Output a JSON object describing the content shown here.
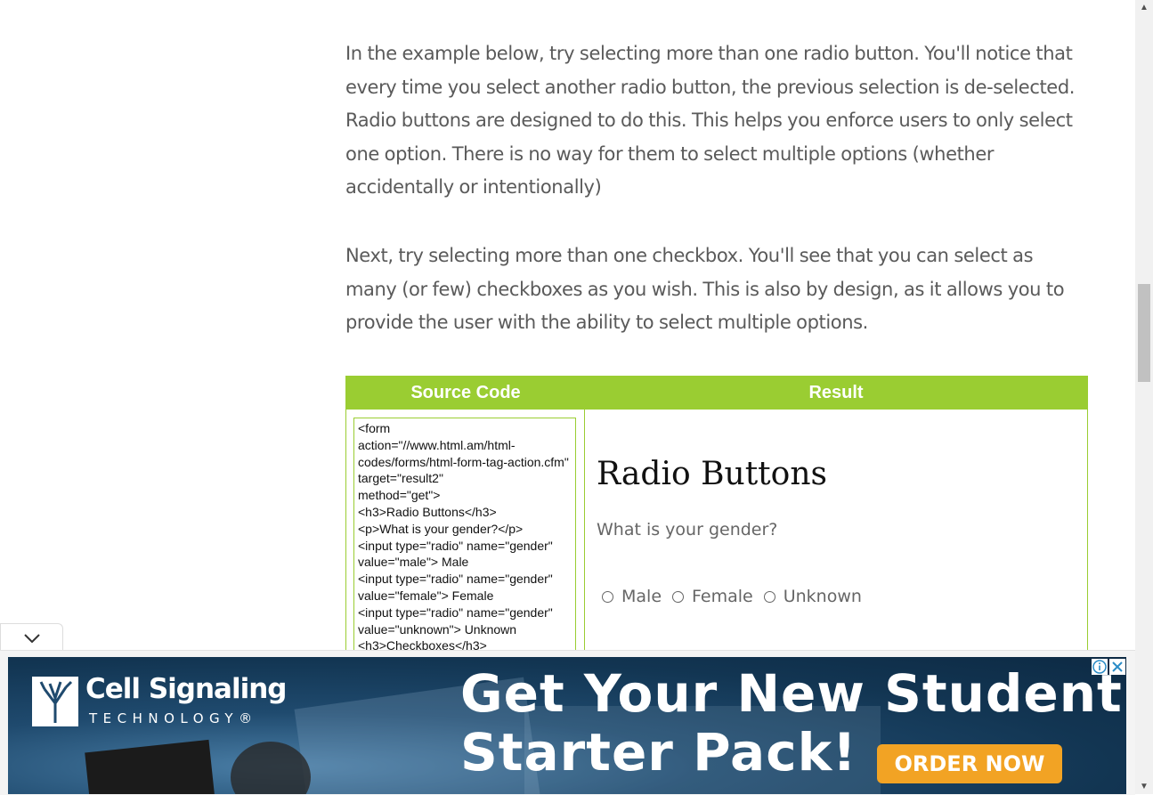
{
  "article": {
    "paragraph_1": "In the example below, try selecting more than one radio button. You'll notice that every time you select another radio button, the previous selection is de-selected. Radio buttons are designed to do this. This helps you enforce users to only select one option. There is no way for them to select multiple options (whether accidentally or intentionally)",
    "paragraph_2": "Next, try selecting more than one checkbox. You'll see that you can select as many (or few) checkboxes as you wish. This is also by design, as it allows you to provide the user with the ability to select multiple options."
  },
  "demo": {
    "source_header": "Source Code",
    "result_header": "Result",
    "source_code": "<form\naction=\"//www.html.am/html-codes/forms/html-form-tag-action.cfm\" target=\"result2\"\nmethod=\"get\">\n<h3>Radio Buttons</h3>\n<p>What is your gender?</p>\n<input type=\"radio\" name=\"gender\"\nvalue=\"male\"> Male\n<input type=\"radio\" name=\"gender\"\nvalue=\"female\"> Female\n<input type=\"radio\" name=\"gender\"\nvalue=\"unknown\"> Unknown\n<h3>Checkboxes</h3>",
    "result": {
      "heading": "Radio Buttons",
      "question": "What is your gender?",
      "options": [
        "Male",
        "Female",
        "Unknown"
      ]
    }
  },
  "ad": {
    "brand_name": "Cell Signaling",
    "brand_sub": "TECHNOLOGY®",
    "headline_line1": "Get Your New Student",
    "headline_line2": "Starter Pack!",
    "cta": "ORDER NOW",
    "colors": {
      "cta": "#f2a324",
      "background": "#1f4a6e"
    }
  },
  "theme": {
    "accent": "#9acd32",
    "body_text": "#5a5a5a"
  },
  "icons": {
    "collapse": "chevron-down-icon",
    "ad_info": "info-icon",
    "ad_close": "close-icon",
    "scroll_up": "arrow-up-icon",
    "scroll_down": "arrow-down-icon"
  }
}
